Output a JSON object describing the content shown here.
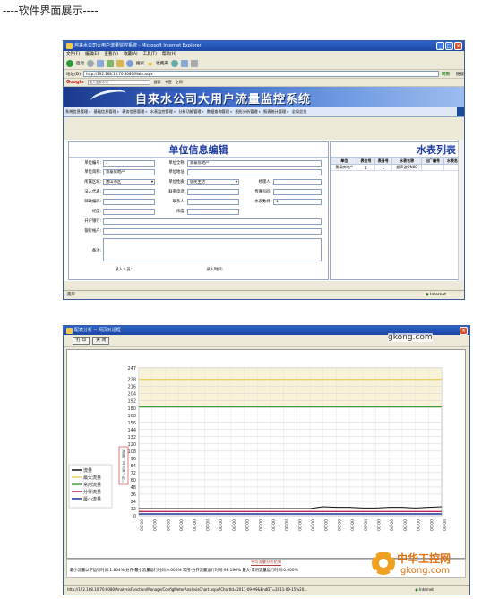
{
  "heading": "----软件界面展示----",
  "window1": {
    "title": "自来水公司大用户流量监控系统 - Microsoft Internet Explorer",
    "menu": [
      "文件(F)",
      "编辑(E)",
      "查看(V)",
      "收藏(A)",
      "工具(T)",
      "帮助(H)"
    ],
    "toolbar": {
      "back": "后退",
      "search": "搜索",
      "favorites": "收藏夹"
    },
    "address_label": "地址(D)",
    "address": "http://192.168.10.70:8080/Main.aspx",
    "go_label": "转到",
    "links_label": "链接",
    "google": {
      "logo": "Google",
      "search_placeholder": "输入搜索字词",
      "search_btn": "搜索",
      "bookmarks": "书签",
      "space": "空间"
    },
    "banner_title": "自来水公司大用户流量监控系统",
    "nav": [
      "系统信息管理",
      "基础信息管理",
      "表务信息管理",
      "水表监控管理",
      "分析功能管理",
      "数据查询管理",
      "图形分析管理",
      "报表统计管理",
      "全局总览"
    ],
    "unit_section_title": "单位信息编辑",
    "form": {
      "unit_code_label": "单位编号:",
      "unit_code": "1",
      "full_name_label": "单位全称:",
      "full_name": "景泰房地产",
      "short_name_label": "单位简称:",
      "short_name": "景泰房地产",
      "address_label": "单位地址:",
      "district_label": "所属区域:",
      "district": "唐山市区",
      "nature_label": "单位性质:",
      "nature": "居民生活",
      "contact_label": "经理人:",
      "legal_label": "法人代表:",
      "phone_label": "联系电话:",
      "fax_label": "传真号码:",
      "postcode_label": "邮政编码:",
      "contact2_label": "联系人:",
      "meter_count_label": "水表数目:",
      "meter_count": "1",
      "lng_label": "经度:",
      "lat_label": "纬度:",
      "bank_label": "开户银行:",
      "account_label": "银行帐户:",
      "remark_label": "备注:",
      "entry_person_label": "录入人员:",
      "entry_time_label": "录入时间:"
    },
    "meter_section_title": "水表列表",
    "meter_table": {
      "headers": [
        "单位",
        "表位号",
        "表身号",
        "水表名称",
        "出厂编号",
        "水表名"
      ],
      "rows": [
        [
          "景泰房地产",
          "1",
          "1",
          "超声波DN80",
          "",
          ""
        ]
      ]
    },
    "status": "完毕",
    "zone": "Internet"
  },
  "window2": {
    "title": "配表分析 -- 网页对话框",
    "print_btn": "打 印",
    "close_btn": "关 闭",
    "side_label": "流量（立方米/时）",
    "result_title": "平均流量分析结果",
    "result_text": "最小流量以下运行时间:1.804%   分界-最小流量运行时间:0.000%   常用-分界流量运行时间:96.196%   最大-常用流量运行时间:0.000%",
    "status_url": "http://192.168.10.70:8080/AnalysisFunction/Manage/ConfigMeterAnalysisChart.aspx?ChartId=2011-09-09&EndDT=2011-09-15%20...",
    "zone": "Internet"
  },
  "chart_data": {
    "type": "line",
    "title": "",
    "xlabel": "",
    "ylabel": "流量（立方米/时）",
    "ylim": [
      0,
      247
    ],
    "yticks": [
      0,
      12,
      24,
      36,
      48,
      60,
      72,
      84,
      96,
      108,
      120,
      132,
      144,
      156,
      168,
      180,
      192,
      204,
      216,
      228,
      247
    ],
    "x": [
      "00:00",
      "00:00",
      "00:00",
      "00:00",
      "00:00",
      "00:00",
      "00:00",
      "00:00",
      "00:00",
      "00:00",
      "00:00",
      "00:00",
      "00:00",
      "00:00",
      "00:00",
      "00:00",
      "00:00",
      "00:00",
      "00:00",
      "00:00",
      "00:00",
      "00:00",
      "00:00",
      "00:00"
    ],
    "grid": true,
    "legend_position": "left",
    "series": [
      {
        "name": "流量",
        "color": "#111111",
        "values": [
          12,
          12,
          12,
          12,
          12,
          12,
          12,
          12,
          12,
          12,
          12,
          12,
          12,
          12,
          15,
          14,
          14,
          13,
          13,
          14,
          14,
          13,
          14,
          15
        ]
      },
      {
        "name": "最大流量",
        "color": "#e8d060",
        "values": [
          228,
          228,
          228,
          228,
          228,
          228,
          228,
          228,
          228,
          228,
          228,
          228,
          228,
          228,
          228,
          228,
          228,
          228,
          228,
          228,
          228,
          228,
          228,
          228
        ]
      },
      {
        "name": "常用流量",
        "color": "#3aa030",
        "values": [
          182,
          182,
          182,
          182,
          182,
          182,
          182,
          182,
          182,
          182,
          182,
          182,
          182,
          182,
          182,
          182,
          182,
          182,
          182,
          182,
          182,
          182,
          182,
          182
        ]
      },
      {
        "name": "分界流量",
        "color": "#c02060",
        "values": [
          7,
          7,
          7,
          7,
          7,
          7,
          7,
          7,
          7,
          7,
          7,
          7,
          7,
          7,
          7,
          7,
          7,
          7,
          7,
          7,
          7,
          7,
          7,
          7
        ]
      },
      {
        "name": "最小流量",
        "color": "#2030a0",
        "values": [
          3,
          3,
          3,
          3,
          3,
          3,
          3,
          3,
          3,
          3,
          3,
          3,
          3,
          3,
          3,
          3,
          3,
          3,
          3,
          3,
          3,
          3,
          3,
          3
        ]
      }
    ]
  },
  "watermark": {
    "line1": "中华工控网",
    "line2": "gkong.com",
    "top_site": "gkong.com"
  }
}
